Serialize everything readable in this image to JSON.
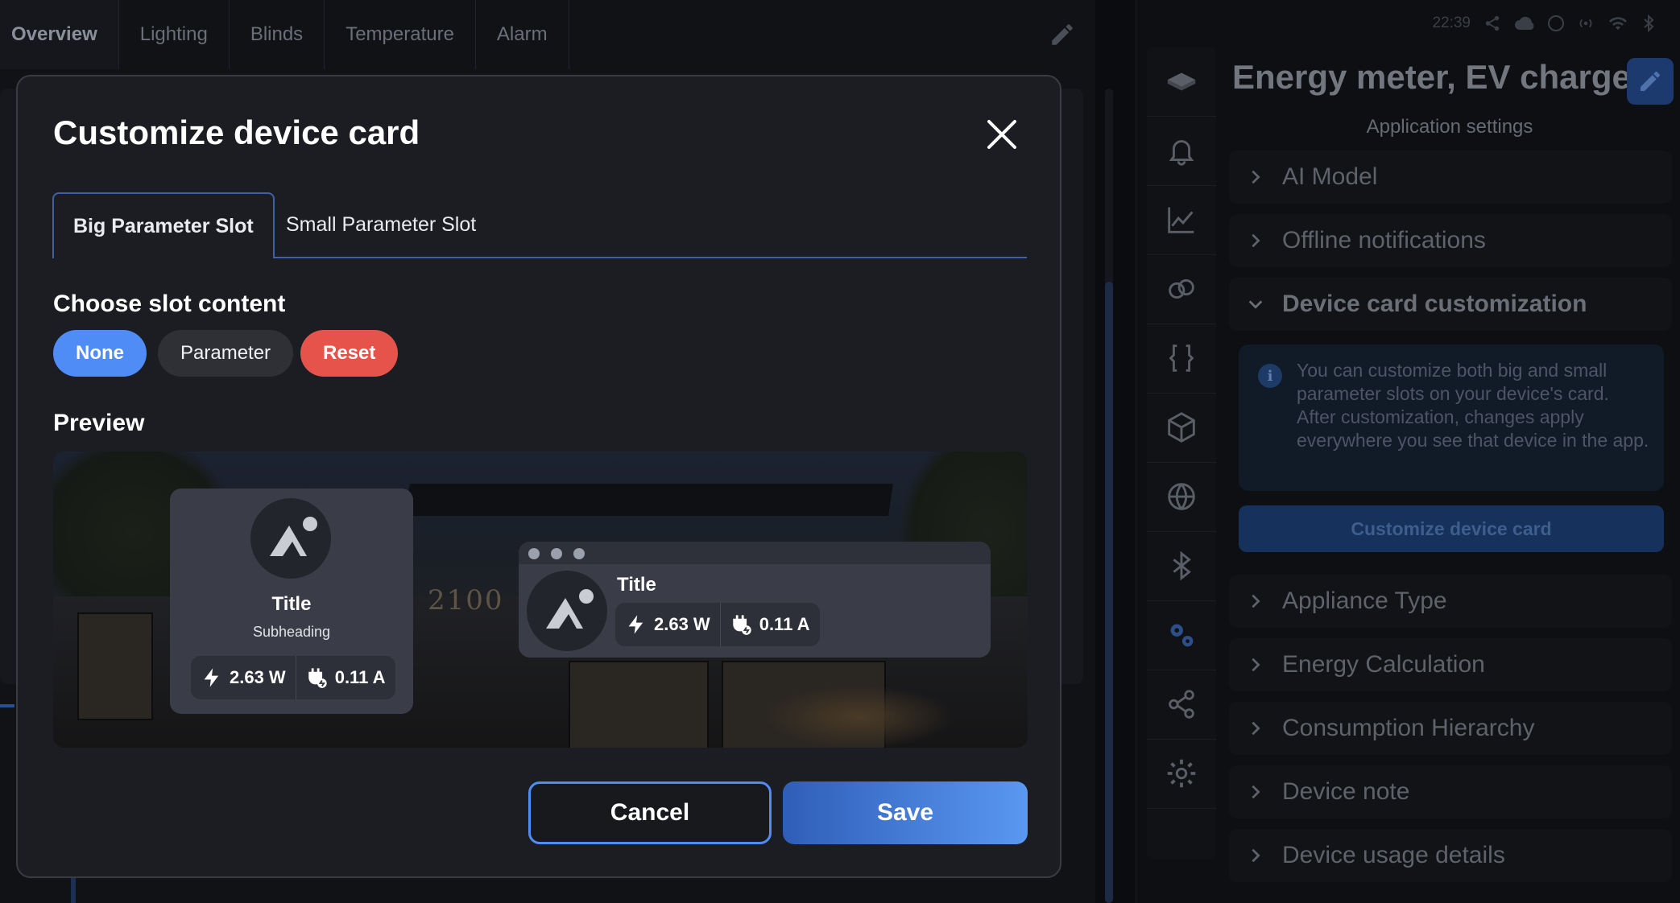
{
  "background": {
    "tabs": [
      "Overview",
      "Lighting",
      "Blinds",
      "Temperature",
      "Alarm"
    ],
    "active_tab": "Overview"
  },
  "statusbar": {
    "time": "22:39"
  },
  "right_panel": {
    "title": "Energy meter, EV charger",
    "subtitle": "Application settings",
    "sections": [
      {
        "label": "AI Model",
        "expanded": false
      },
      {
        "label": "Offline notifications",
        "expanded": false
      },
      {
        "label": "Device card customization",
        "expanded": true
      },
      {
        "label": "Appliance Type",
        "expanded": false
      },
      {
        "label": "Energy Calculation",
        "expanded": false
      },
      {
        "label": "Consumption Hierarchy",
        "expanded": false
      },
      {
        "label": "Device note",
        "expanded": false
      },
      {
        "label": "Device usage details",
        "expanded": false
      }
    ],
    "info_text": "You can customize both big and small parameter slots on your device's card. After customization, changes apply everywhere you see that device in the app.",
    "customize_button": "Customize device card",
    "rail_icons": [
      "device-icon",
      "bell-icon",
      "chart-icon",
      "link-icon",
      "braces-icon",
      "cube-icon",
      "globe-icon",
      "bluetooth-icon",
      "gears-icon",
      "share-icon",
      "settings-icon"
    ]
  },
  "modal": {
    "title": "Customize device card",
    "tabs": [
      "Big Parameter Slot",
      "Small Parameter Slot"
    ],
    "active_tab": "Big Parameter Slot",
    "choose_heading": "Choose slot content",
    "options": [
      "None",
      "Parameter",
      "Reset"
    ],
    "selected_option": "None",
    "preview_heading": "Preview",
    "preview": {
      "title": "Title",
      "subheading": "Subheading",
      "power": "2.63 W",
      "current": "0.11 A",
      "background_sign": "2100"
    },
    "cancel": "Cancel",
    "save": "Save"
  },
  "colors": {
    "accent": "#4f8cf5",
    "danger": "#e5534b",
    "modal_bg": "#1c1d22"
  }
}
